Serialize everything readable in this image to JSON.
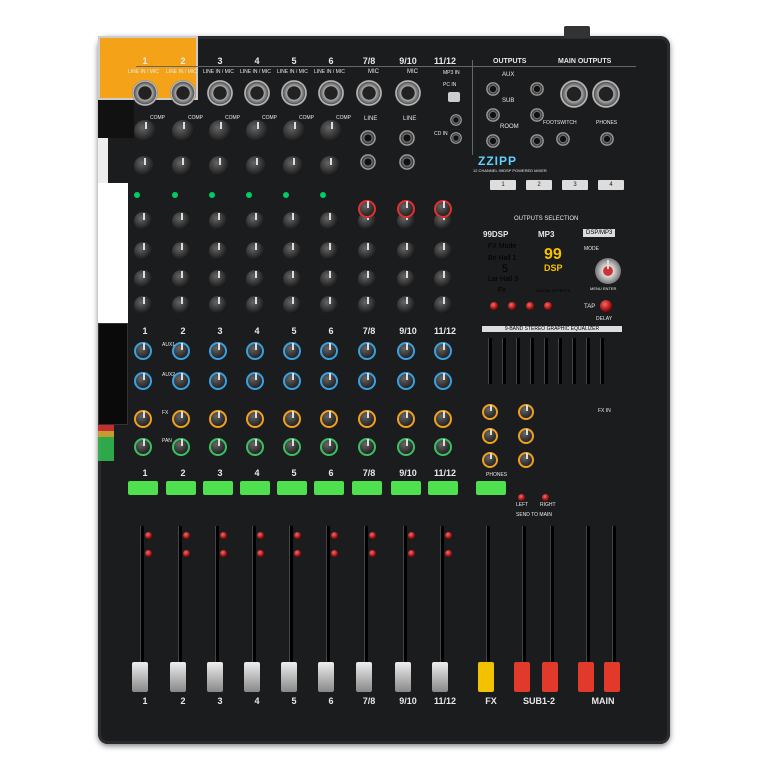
{
  "brand": {
    "name": "ZZIPP",
    "subtitle": "12 CHANNEL 99DSP POWERED MIXER"
  },
  "channels": [
    "1",
    "2",
    "3",
    "4",
    "5",
    "6",
    "7/8",
    "9/10",
    "11/12"
  ],
  "input_labels": {
    "line_in_mic": "LINE IN / MIC",
    "mic": "MIC",
    "line": "LINE",
    "comp": "COMP",
    "phantom": "PHANTOM ON"
  },
  "aux_labels": {
    "aux1": "AUX1",
    "aux2": "AUX2",
    "fx": "FX",
    "pan": "PAN",
    "pre": "PRE"
  },
  "mp3": {
    "mp3_in": "MP3 IN",
    "pc_in": "PC IN",
    "cd_in": "CD IN"
  },
  "outputs": {
    "title": "OUTPUTS",
    "main_title": "MAIN OUTPUTS",
    "aux": "AUX",
    "sub": "SUB",
    "room": "ROOM",
    "footswitch": "FOOTSWITCH",
    "phones": "PHONES",
    "selection": "OUTPUTS SELECTION",
    "sel_buttons": [
      "1",
      "2",
      "3",
      "4"
    ]
  },
  "dsp": {
    "logo": "99DSP",
    "mp3_label": "MP3",
    "mode_btn": "DSP/MP3",
    "mode": "MODE",
    "menu_enter": "MENU ENTER",
    "tap": "TAP",
    "delay": "DELAY",
    "lcd_line1": "FX Mode",
    "lcd_line2": "Bri Hall 1",
    "lcd_num": "5",
    "lcd_line3": "Lar Hall 3",
    "lcd_line4": "Fx",
    "badge_num": "99",
    "badge_dsp": "DSP",
    "badge_sub": "DIGITAL EFFECTS"
  },
  "eq": {
    "title": "9-BAND STEREO GRAPHIC EQUALIZER"
  },
  "master": {
    "send_to_main": "SEND TO MAIN",
    "left": "LEFT",
    "right": "RIGHT",
    "fx_label": "FX",
    "sub12": "SUB1-2",
    "main": "MAIN",
    "phones": "PHONES",
    "fx_in": "FX IN"
  },
  "bottom_labels": [
    "1",
    "2",
    "3",
    "4",
    "5",
    "6",
    "7/8",
    "9/10",
    "11/12",
    "FX",
    "SUB1-2",
    "MAIN"
  ],
  "colors": {
    "body": "#1b1c1e",
    "lcd_green": "#4ee04e",
    "fader_red": "#e23a2a",
    "fader_yellow": "#f2c200",
    "knob_blue": "#3aa0e0",
    "knob_green": "#3ac060",
    "knob_orange": "#f0a020",
    "knob_red": "#e03030"
  }
}
